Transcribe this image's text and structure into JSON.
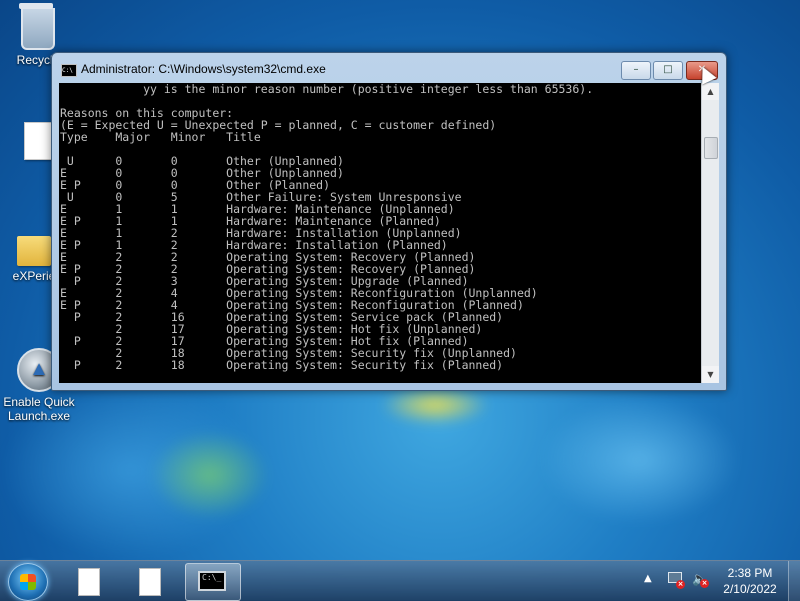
{
  "desktop": {
    "icons": [
      {
        "label": "Recycle",
        "icon": "recycle-bin-icon"
      },
      {
        "label": "",
        "icon": "document-icon"
      },
      {
        "label": "eXPerie",
        "icon": "folder-icon"
      },
      {
        "label": "Enable Quick Launch.exe",
        "icon": "app-icon"
      }
    ]
  },
  "window": {
    "title": "Administrator: C:\\Windows\\system32\\cmd.exe",
    "icon": "cmd-icon",
    "minimize_label": "–",
    "maximize_label": "□",
    "close_label": "✕",
    "console_lines": [
      "            yy is the minor reason number (positive integer less than 65536).",
      "",
      "Reasons on this computer:",
      "(E = Expected U = Unexpected P = planned, C = customer defined)",
      "Type    Major   Minor   Title",
      "",
      " U      0       0       Other (Unplanned)",
      "E       0       0       Other (Unplanned)",
      "E P     0       0       Other (Planned)",
      " U      0       5       Other Failure: System Unresponsive",
      "E       1       1       Hardware: Maintenance (Unplanned)",
      "E P     1       1       Hardware: Maintenance (Planned)",
      "E       1       2       Hardware: Installation (Unplanned)",
      "E P     1       2       Hardware: Installation (Planned)",
      "E       2       2       Operating System: Recovery (Planned)",
      "E P     2       2       Operating System: Recovery (Planned)",
      "  P     2       3       Operating System: Upgrade (Planned)",
      "E       2       4       Operating System: Reconfiguration (Unplanned)",
      "E P     2       4       Operating System: Reconfiguration (Planned)",
      "  P     2       16      Operating System: Service pack (Planned)",
      "        2       17      Operating System: Hot fix (Unplanned)",
      "  P     2       17      Operating System: Hot fix (Planned)",
      "        2       18      Operating System: Security fix (Unplanned)",
      "  P     2       18      Operating System: Security fix (Planned)"
    ]
  },
  "taskbar": {
    "buttons": [
      {
        "name": "document-1",
        "icon": "document-icon"
      },
      {
        "name": "document-2",
        "icon": "document-icon"
      },
      {
        "name": "cmd",
        "icon": "cmd-icon",
        "active": true
      }
    ],
    "tray": {
      "show_hidden": "▲",
      "network_status": "disconnected",
      "volume_status": "muted"
    },
    "clock": {
      "time": "2:38 PM",
      "date": "2/10/2022"
    }
  }
}
